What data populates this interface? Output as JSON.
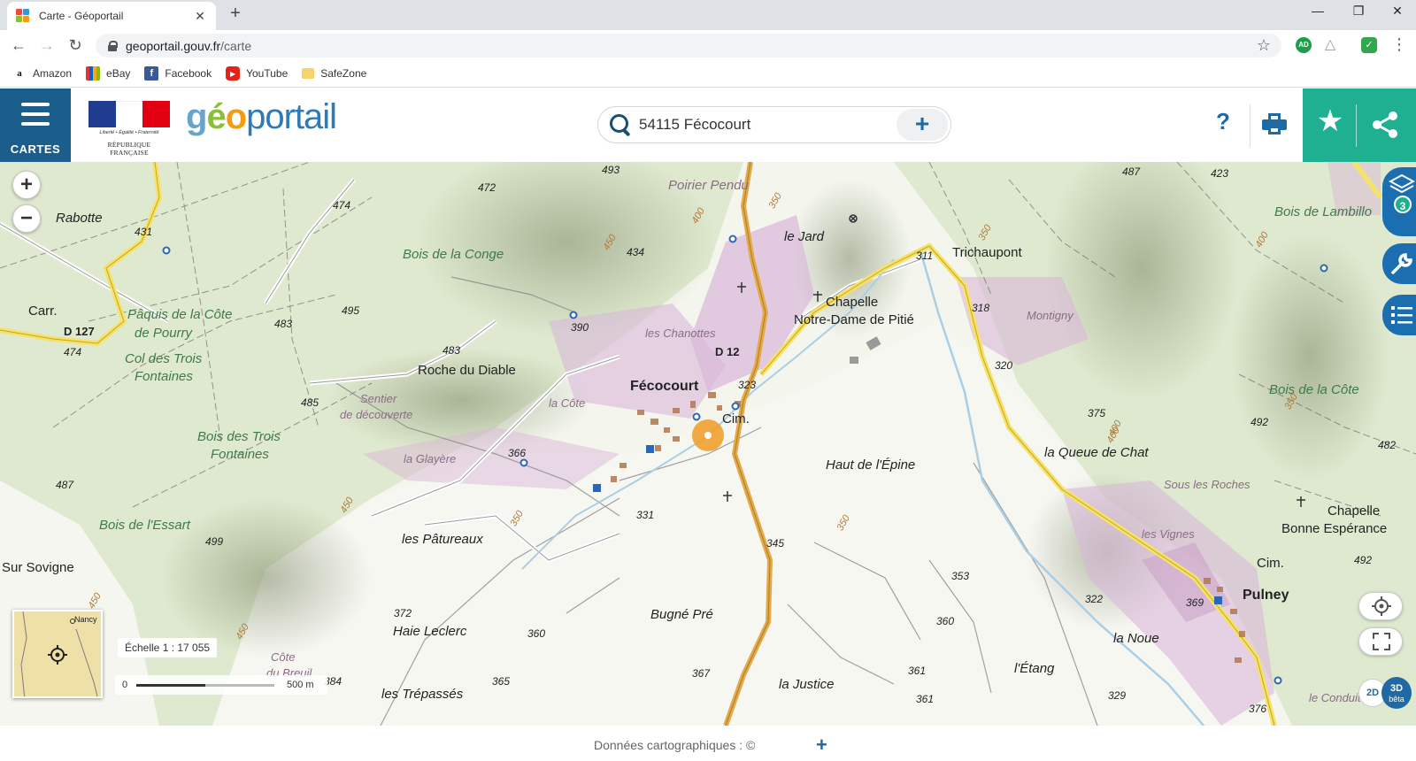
{
  "browser": {
    "tab_title": "Carte - Géoportail",
    "url_host": "geoportail.gouv.fr",
    "url_path": "/carte",
    "bookmarks": [
      {
        "label": "Amazon",
        "icon": "amazon-icon"
      },
      {
        "label": "eBay",
        "icon": "ebay-icon"
      },
      {
        "label": "Facebook",
        "icon": "facebook-icon"
      },
      {
        "label": "YouTube",
        "icon": "youtube-icon"
      },
      {
        "label": "SafeZone",
        "icon": "folder-icon"
      }
    ],
    "extensions": [
      {
        "label": "AD",
        "color": "#1e9e4a"
      },
      {
        "label": "",
        "color": "#9aa0a6"
      },
      {
        "label": "",
        "color": "#2fa84f"
      }
    ]
  },
  "header": {
    "menu_label": "CARTES",
    "devise": "Liberté • Égalité • Fraternité",
    "republique": "RÉPUBLIQUE FRANÇAISE",
    "logo": {
      "p1": "g",
      "p2": "é",
      "p3": "o",
      "p4": "portail"
    },
    "search_value": "54115 Fécocourt",
    "help_label": "?",
    "colors": {
      "blue": "#1b5e8c",
      "green": "#1fb092",
      "accent": "#1f6aa5"
    }
  },
  "map": {
    "places": [
      {
        "text": "Poirier Pendu",
        "cls": "italic",
        "color": "#8a6c86"
      },
      {
        "text": "le Jard",
        "cls": "italic"
      },
      {
        "text": "Trichaupont",
        "cls": ""
      },
      {
        "text": "Rabotte",
        "cls": "italic"
      },
      {
        "text": "Bois de la Conge",
        "cls": "forest"
      },
      {
        "text": "Carr.",
        "cls": ""
      },
      {
        "text": "Pâquis de la Côte",
        "cls": "forest"
      },
      {
        "text": "de Pourry",
        "cls": "forest"
      },
      {
        "text": "D 127",
        "cls": "road"
      },
      {
        "text": "Col des Trois",
        "cls": "forest"
      },
      {
        "text": "Fontaines",
        "cls": "forest"
      },
      {
        "text": "Roche du Diable",
        "cls": ""
      },
      {
        "text": "Chapelle",
        "cls": ""
      },
      {
        "text": "Notre-Dame de Pitié",
        "cls": ""
      },
      {
        "text": "Montigny",
        "cls": "pinkl"
      },
      {
        "text": "les Chanottes",
        "cls": "pinkl"
      },
      {
        "text": "D 12",
        "cls": "road"
      },
      {
        "text": "Fécocourt",
        "cls": "big"
      },
      {
        "text": "la Côte",
        "cls": "pinkl"
      },
      {
        "text": "Sentier",
        "cls": "pinkl"
      },
      {
        "text": "de découverte",
        "cls": "pinkl"
      },
      {
        "text": "Cim.",
        "cls": ""
      },
      {
        "text": "Bois des Trois",
        "cls": "forest"
      },
      {
        "text": "Fontaines",
        "cls": "forest"
      },
      {
        "text": "la Glayère",
        "cls": "pinkl"
      },
      {
        "text": "Haut de l'Épine",
        "cls": "italic"
      },
      {
        "text": "la Queue de Chat",
        "cls": "italic"
      },
      {
        "text": "Bois de Lambillo",
        "cls": "forest"
      },
      {
        "text": "Bois de la Côte",
        "cls": "forest"
      },
      {
        "text": "Sous les Roches",
        "cls": "pinkl"
      },
      {
        "text": "Chapelle",
        "cls": ""
      },
      {
        "text": "Bonne Espérance",
        "cls": ""
      },
      {
        "text": "les Vignes",
        "cls": "pinkl"
      },
      {
        "text": "Cim.",
        "cls": ""
      },
      {
        "text": "Pulney",
        "cls": "big"
      },
      {
        "text": "Bois de l'Essart",
        "cls": "forest"
      },
      {
        "text": "Sur Sovigne",
        "cls": ""
      },
      {
        "text": "les Pâtureaux",
        "cls": "italic"
      },
      {
        "text": "Bugné Pré",
        "cls": "italic"
      },
      {
        "text": "la Noue",
        "cls": "italic"
      },
      {
        "text": "l'Étang",
        "cls": "italic"
      },
      {
        "text": "Haie Leclerc",
        "cls": "italic"
      },
      {
        "text": "Côte",
        "cls": "pinkl"
      },
      {
        "text": "du Breuil",
        "cls": "pinkl"
      },
      {
        "text": "les Trépassés",
        "cls": "italic"
      },
      {
        "text": "la Justice",
        "cls": "italic"
      },
      {
        "text": "le Conduit",
        "cls": "pinkl"
      }
    ],
    "altitudes": [
      {
        "text": "493"
      },
      {
        "text": "472"
      },
      {
        "text": "474"
      },
      {
        "text": "431"
      },
      {
        "text": "434"
      },
      {
        "text": "495"
      },
      {
        "text": "483"
      },
      {
        "text": "474"
      },
      {
        "text": "483"
      },
      {
        "text": "485"
      },
      {
        "text": "390"
      },
      {
        "text": "323"
      },
      {
        "text": "366"
      },
      {
        "text": "487"
      },
      {
        "text": "499"
      },
      {
        "text": "331"
      },
      {
        "text": "345"
      },
      {
        "text": "311"
      },
      {
        "text": "318"
      },
      {
        "text": "320"
      },
      {
        "text": "375"
      },
      {
        "text": "487"
      },
      {
        "text": "423"
      },
      {
        "text": "492"
      },
      {
        "text": "482"
      },
      {
        "text": "492"
      },
      {
        "text": "353"
      },
      {
        "text": "360"
      },
      {
        "text": "322"
      },
      {
        "text": "369"
      },
      {
        "text": "372"
      },
      {
        "text": "360"
      },
      {
        "text": "361"
      },
      {
        "text": "367"
      },
      {
        "text": "365"
      },
      {
        "text": "384"
      },
      {
        "text": "361"
      },
      {
        "text": "329"
      },
      {
        "text": "376"
      }
    ],
    "contours": [
      {
        "text": "350"
      },
      {
        "text": "400"
      },
      {
        "text": "450"
      },
      {
        "text": "350"
      },
      {
        "text": "400"
      },
      {
        "text": "350"
      },
      {
        "text": "350"
      },
      {
        "text": "400"
      },
      {
        "text": "450"
      },
      {
        "text": "450"
      },
      {
        "text": "350"
      },
      {
        "text": "400"
      },
      {
        "text": "450"
      }
    ],
    "layers_count": "3",
    "minimap_label": "Nancy",
    "scale_label": "Échelle 1 : 17 055",
    "scalebar_zero": "0",
    "scalebar_max": "500 m",
    "view_2d": "2D",
    "view_3d": "3D",
    "view_3d_sub": "bêta"
  },
  "footer": {
    "attribution": "Données cartographiques : ©",
    "more_label": "+"
  }
}
